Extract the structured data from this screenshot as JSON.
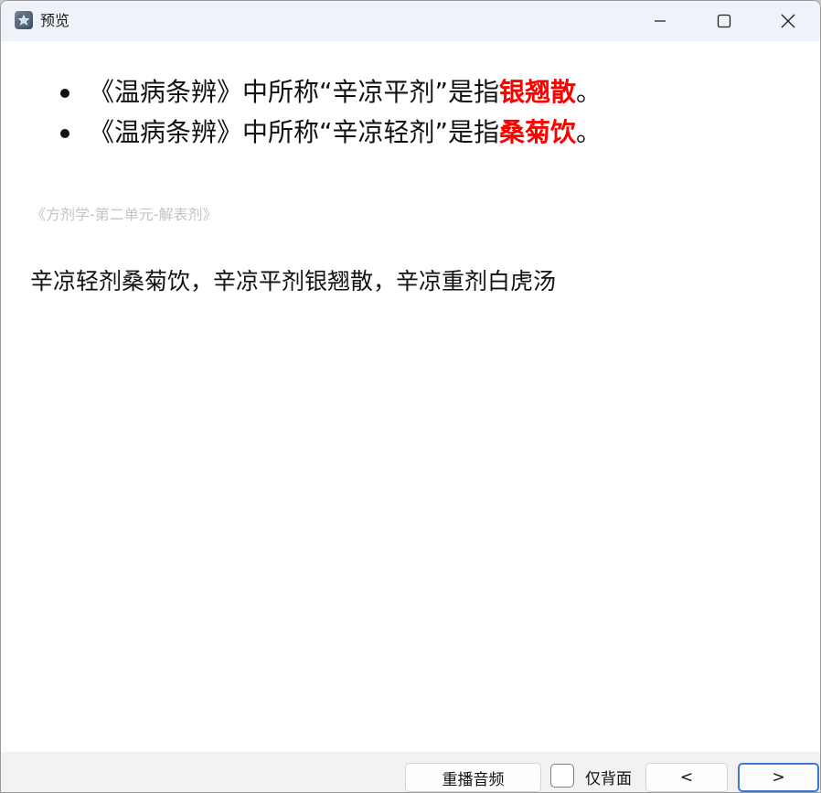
{
  "window": {
    "title": "预览",
    "icon": "app-star-icon",
    "controls": [
      "minimize-icon",
      "maximize-icon",
      "close-icon"
    ]
  },
  "card": {
    "items": [
      {
        "prefix": "《温病条辨》中所称“辛凉平剂”是指",
        "highlight": "银翘散",
        "suffix": "。"
      },
      {
        "prefix": "《温病条辨》中所称“辛凉轻剂”是指",
        "highlight": "桑菊饮",
        "suffix": "。"
      }
    ],
    "source": "《方剂学-第二单元-解表剂》",
    "answer": "辛凉轻剂桑菊饮，辛凉平剂银翘散，辛凉重剂白虎汤",
    "highlight_color": "#ff0000"
  },
  "bottom": {
    "replay_label": "重播音频",
    "back_only_label": "仅背面",
    "back_only_checked": false,
    "prev_label": "<",
    "next_label": ">"
  }
}
